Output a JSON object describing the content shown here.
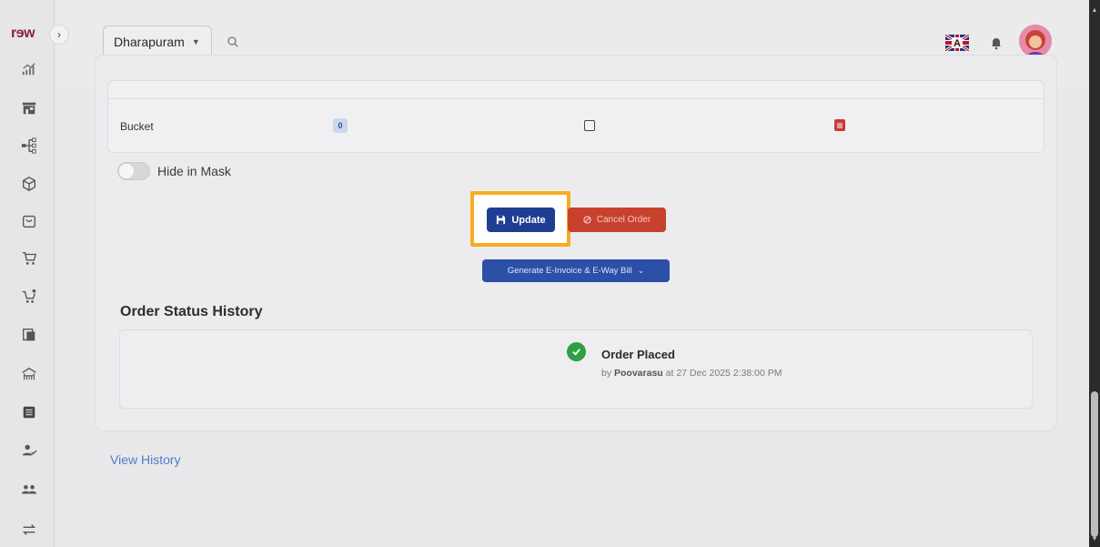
{
  "app": {
    "logo_text": "rɘw"
  },
  "header": {
    "location": "Dharapuram",
    "icons": [
      "search-icon",
      "language-flag-icon",
      "bell-icon",
      "avatar"
    ]
  },
  "sidebar": {
    "items": [
      "analytics-icon",
      "store-icon",
      "hierarchy-icon",
      "box-icon",
      "bag-icon",
      "cart-icon",
      "cart-add-icon",
      "copy-icon",
      "warehouse-icon",
      "list-icon",
      "user-check-icon",
      "users-icon",
      "transfer-icon"
    ]
  },
  "order_items": {
    "row": {
      "name": "Bucket",
      "qty": "0"
    }
  },
  "mask_toggle": {
    "label": "Hide in Mask",
    "on": false
  },
  "actions": {
    "update": "Update",
    "cancel": "Cancel Order",
    "einvoice": "Generate E-Invoice & E-Way Bill"
  },
  "history": {
    "title": "Order Status History",
    "entry": {
      "status": "Order Placed",
      "by_prefix": "by",
      "user": "Poovarasu",
      "at_text": "at 27 Dec 2025 2:38:00 PM"
    },
    "view_link": "View History"
  },
  "colors": {
    "primary": "#1f3e91",
    "danger": "#c8412e",
    "highlight": "#f6ad1f",
    "success": "#2f9e44"
  }
}
